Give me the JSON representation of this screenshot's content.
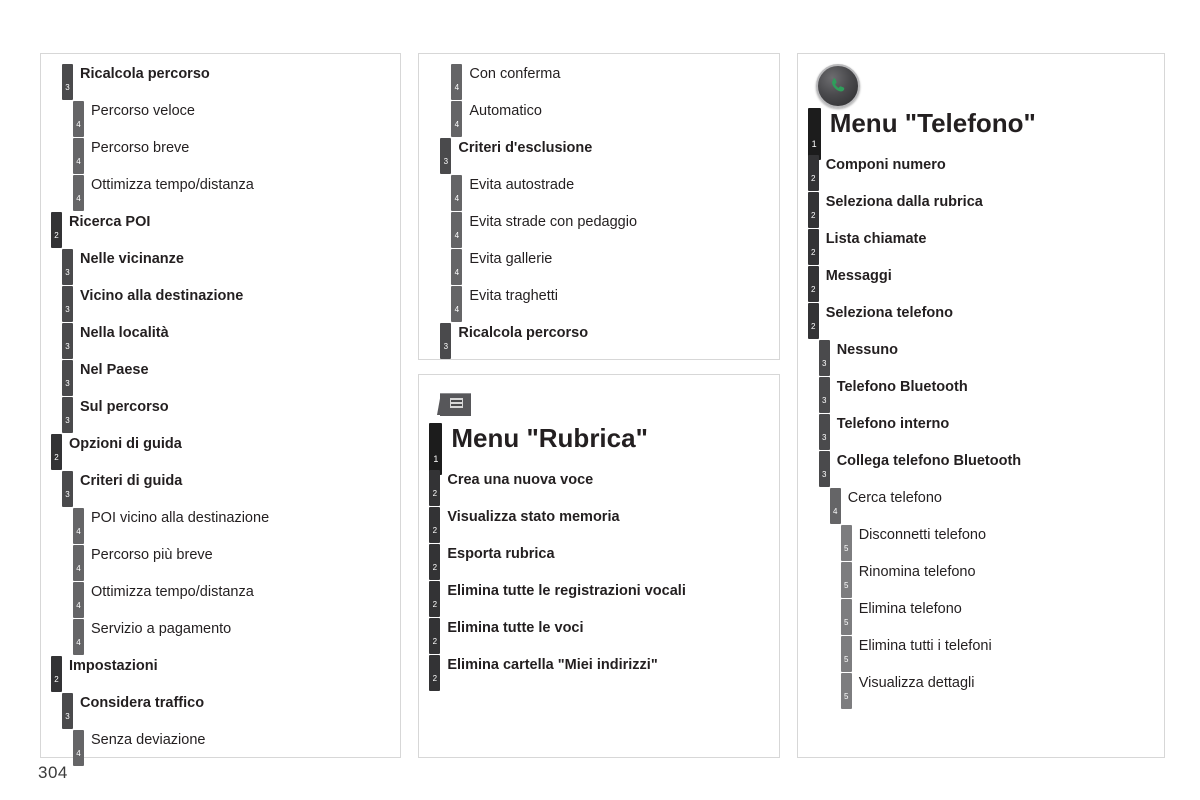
{
  "page": {
    "number": "304"
  },
  "colors": {
    "level1": "#1c1c1c",
    "level2": "#333335",
    "level3": "#4a4a4c",
    "level4": "#656567",
    "level5": "#7d7d7f",
    "panel_border": "#d7d7d7",
    "text": "#231f20",
    "phone_icon_green": "#2f9e5b"
  },
  "columns": [
    {
      "id": "column-left",
      "panels": [
        {
          "id": "panel-navigazione-continuazione",
          "icon": null,
          "entries": [
            {
              "level": 3,
              "label": "Ricalcola percorso"
            },
            {
              "level": 4,
              "label": "Percorso veloce"
            },
            {
              "level": 4,
              "label": "Percorso breve"
            },
            {
              "level": 4,
              "label": "Ottimizza tempo/distanza"
            },
            {
              "level": 2,
              "label": "Ricerca POI"
            },
            {
              "level": 3,
              "label": "Nelle vicinanze"
            },
            {
              "level": 3,
              "label": "Vicino alla destinazione"
            },
            {
              "level": 3,
              "label": "Nella località"
            },
            {
              "level": 3,
              "label": "Nel Paese"
            },
            {
              "level": 3,
              "label": "Sul percorso"
            },
            {
              "level": 2,
              "label": "Opzioni di guida"
            },
            {
              "level": 3,
              "label": "Criteri di guida"
            },
            {
              "level": 4,
              "label": "POI vicino alla destinazione"
            },
            {
              "level": 4,
              "label": "Percorso più breve"
            },
            {
              "level": 4,
              "label": "Ottimizza tempo/distanza"
            },
            {
              "level": 4,
              "label": "Servizio a pagamento"
            },
            {
              "level": 2,
              "label": "Impostazioni"
            },
            {
              "level": 3,
              "label": "Considera traffico"
            },
            {
              "level": 4,
              "label": "Senza deviazione"
            }
          ]
        }
      ]
    },
    {
      "id": "column-middle",
      "panels": [
        {
          "id": "panel-criteri-esclusione",
          "icon": null,
          "entries": [
            {
              "level": 4,
              "label": "Con conferma"
            },
            {
              "level": 4,
              "label": "Automatico"
            },
            {
              "level": 3,
              "label": "Criteri d'esclusione"
            },
            {
              "level": 4,
              "label": "Evita autostrade"
            },
            {
              "level": 4,
              "label": "Evita strade con pedaggio"
            },
            {
              "level": 4,
              "label": "Evita gallerie"
            },
            {
              "level": 4,
              "label": "Evita traghetti"
            },
            {
              "level": 3,
              "label": "Ricalcola percorso"
            }
          ]
        },
        {
          "id": "panel-menu-rubrica",
          "icon": "address-book-icon",
          "entries": [
            {
              "level": 1,
              "label": "Menu \"Rubrica\""
            },
            {
              "level": 2,
              "label": "Crea una nuova voce"
            },
            {
              "level": 2,
              "label": "Visualizza stato memoria"
            },
            {
              "level": 2,
              "label": "Esporta rubrica"
            },
            {
              "level": 2,
              "label": "Elimina tutte le registrazioni vocali"
            },
            {
              "level": 2,
              "label": "Elimina tutte le voci"
            },
            {
              "level": 2,
              "label": "Elimina cartella \"Miei indirizzi\""
            }
          ]
        }
      ]
    },
    {
      "id": "column-right",
      "panels": [
        {
          "id": "panel-menu-telefono",
          "icon": "phone-icon",
          "entries": [
            {
              "level": 1,
              "label": "Menu \"Telefono\""
            },
            {
              "level": 2,
              "label": "Componi numero"
            },
            {
              "level": 2,
              "label": "Seleziona dalla rubrica"
            },
            {
              "level": 2,
              "label": "Lista chiamate"
            },
            {
              "level": 2,
              "label": "Messaggi"
            },
            {
              "level": 2,
              "label": "Seleziona telefono"
            },
            {
              "level": 3,
              "label": "Nessuno"
            },
            {
              "level": 3,
              "label": "Telefono Bluetooth"
            },
            {
              "level": 3,
              "label": "Telefono interno"
            },
            {
              "level": 3,
              "label": "Collega telefono Bluetooth"
            },
            {
              "level": 4,
              "label": "Cerca telefono"
            },
            {
              "level": 5,
              "label": "Disconnetti telefono"
            },
            {
              "level": 5,
              "label": "Rinomina telefono"
            },
            {
              "level": 5,
              "label": "Elimina telefono"
            },
            {
              "level": 5,
              "label": "Elimina tutti i telefoni"
            },
            {
              "level": 5,
              "label": "Visualizza dettagli"
            }
          ]
        }
      ]
    }
  ]
}
